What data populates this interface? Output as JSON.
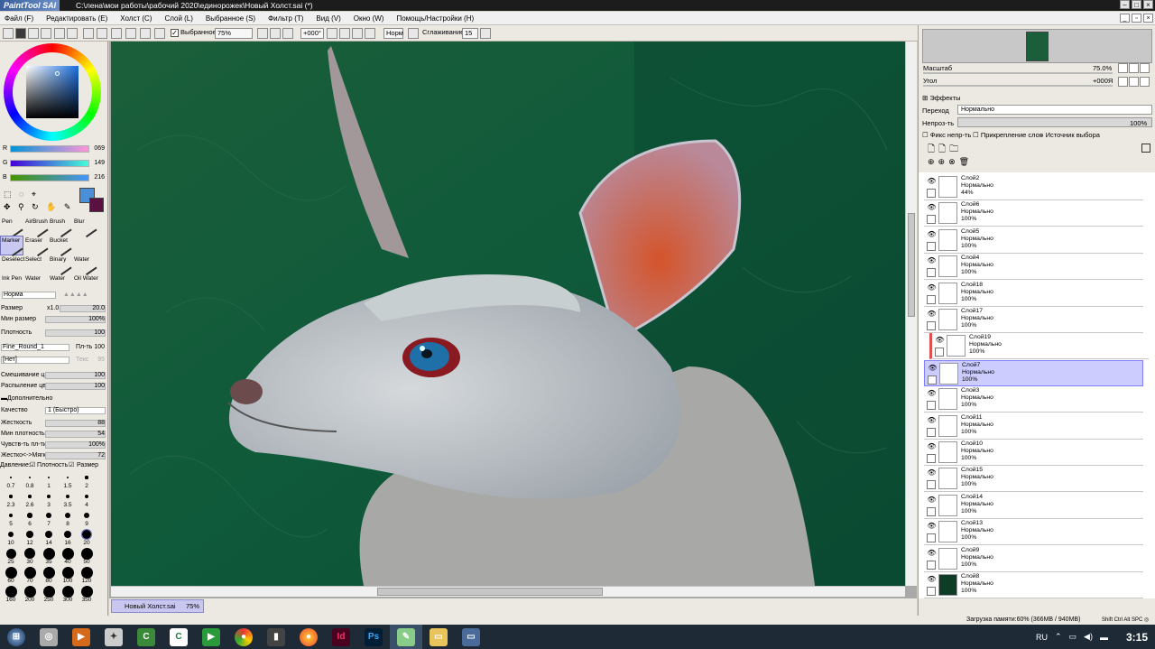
{
  "window": {
    "logo": "PaintTool SAI",
    "title": "C:\\лена\\мои работы\\рабочий 2020\\единорожек\\Новый Холст.sai (*)"
  },
  "menu": [
    "Файл (F)",
    "Редактировать (E)",
    "Холст (C)",
    "Слой (L)",
    "Выбранное (S)",
    "Фильтр (T)",
    "Вид (V)",
    "Окно (W)",
    "Помощь/Настройки (H)"
  ],
  "toolbar": {
    "selection_label": "Выбранное",
    "zoom": "75%",
    "angle": "+000°",
    "mode": "Норм",
    "smoothing_label": "Сглаживание",
    "smoothing_value": "15"
  },
  "colors": {
    "primary": "#4a8fd8",
    "secondary": "#5a1040"
  },
  "rgb": {
    "r_label": "R",
    "r": "069",
    "g_label": "G",
    "g": "149",
    "b_label": "B",
    "b": "216"
  },
  "tools": [
    "Pen",
    "AirBrush",
    "Brush",
    "Blur",
    "Marker",
    "Eraser",
    "Bucket",
    "Deselect",
    "Select",
    "Binary",
    "Water",
    "Ink Pen",
    "Water",
    "Water",
    "Oil Water"
  ],
  "brush": {
    "blend_mode": "Норма",
    "size_label": "Размер",
    "size_mult": "x1.0",
    "size": "20.0",
    "min_size_label": "Мин размер",
    "min_size": "100%",
    "density_label": "Плотность",
    "density": "100",
    "shape": "Fine_Round_1",
    "shape_label": "Пл-ть",
    "shape_value": "100",
    "texture": "[Нет]",
    "texture_label": "Текс",
    "texture_value": "95",
    "color_mix_label": "Смешивание цвет",
    "color_mix": "100",
    "spray_label": "Распыление цвет",
    "spray": "100",
    "advanced_label": "Дополнительно",
    "quality_label": "Качество",
    "quality": "1 (Быстро)",
    "hardness_label": "Жесткость",
    "hardness": "88",
    "min_density_label": "Мин плотность",
    "min_density": "54",
    "sensitivity_label": "Чувств-ть пл-ти",
    "sensitivity": "100%",
    "hard_soft_label": "Жестко<->Мягко",
    "hard_soft": "72",
    "pressure_label": "Давление:",
    "pressure_density": "Плотность",
    "pressure_size": "Размер"
  },
  "brush_sizes": [
    "0.7",
    "0.8",
    "1",
    "1.5",
    "2",
    "2.3",
    "2.6",
    "3",
    "3.5",
    "4",
    "5",
    "6",
    "7",
    "8",
    "9",
    "10",
    "12",
    "14",
    "16",
    "20",
    "25",
    "30",
    "35",
    "40",
    "50",
    "60",
    "70",
    "80",
    "100",
    "120",
    "160",
    "200",
    "250",
    "300",
    "350"
  ],
  "navigator": {
    "scale_label": "Масштаб",
    "scale": "75.0%",
    "angle_label": "Угол",
    "angle": "+000Я"
  },
  "layer_panel": {
    "effects_label": "Эффекты",
    "blend_label": "Переход",
    "blend": "Нормально",
    "opacity_label": "Непроз-ть",
    "opacity": "100%",
    "opt1": "Фикс непр-ть",
    "opt2": "Прикрепление слоя",
    "opt3": "Источник выбора"
  },
  "layers": [
    {
      "name": "Слой2",
      "mode": "Нормально",
      "opacity": "44%"
    },
    {
      "name": "Слой6",
      "mode": "Нормально",
      "opacity": "100%"
    },
    {
      "name": "Слой5",
      "mode": "Нормально",
      "opacity": "100%"
    },
    {
      "name": "Слой4",
      "mode": "Нормально",
      "opacity": "100%"
    },
    {
      "name": "Слой18",
      "mode": "Нормально",
      "opacity": "100%"
    },
    {
      "name": "Слой17",
      "mode": "Нормально",
      "opacity": "100%"
    },
    {
      "name": "Слой19",
      "mode": "Нормально",
      "opacity": "100%"
    },
    {
      "name": "Слой7",
      "mode": "Нормально",
      "opacity": "100%"
    },
    {
      "name": "Слой3",
      "mode": "Нормально",
      "opacity": "100%"
    },
    {
      "name": "Слой11",
      "mode": "Нормально",
      "opacity": "100%"
    },
    {
      "name": "Слой10",
      "mode": "Нормально",
      "opacity": "100%"
    },
    {
      "name": "Слой15",
      "mode": "Нормально",
      "opacity": "100%"
    },
    {
      "name": "Слой14",
      "mode": "Нормально",
      "opacity": "100%"
    },
    {
      "name": "Слой13",
      "mode": "Нормально",
      "opacity": "100%"
    },
    {
      "name": "Слой9",
      "mode": "Нормально",
      "opacity": "100%"
    },
    {
      "name": "Слой8",
      "mode": "Нормально",
      "opacity": "100%"
    }
  ],
  "document_tab": {
    "name": "Новый Холст.sai",
    "zoom": "75%"
  },
  "status": {
    "memory": "Загрузка памяти:60% (366MB / 940MB)",
    "keys": "Shift Ctrl Alt SPC ◎ Any"
  },
  "taskbar": {
    "lang": "RU",
    "time": "3:15"
  }
}
